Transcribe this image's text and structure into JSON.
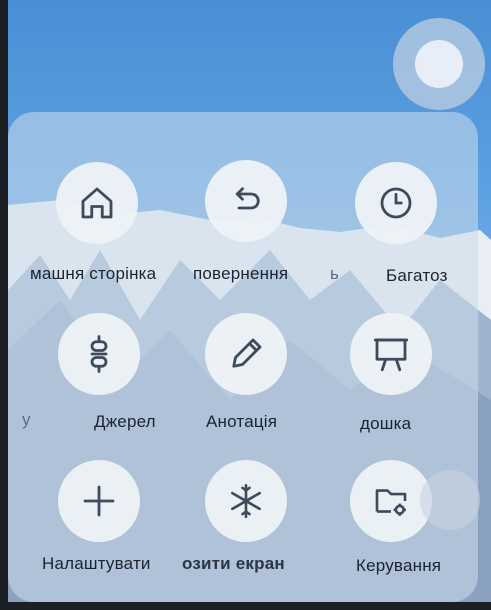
{
  "menu": {
    "items": [
      {
        "label": "машня сторінка",
        "icon": "home-icon"
      },
      {
        "label": "повернення",
        "icon": "undo-icon"
      },
      {
        "label": "Багатоз",
        "icon": "clock-icon"
      },
      {
        "label": "Джерел",
        "icon": "plug-icon"
      },
      {
        "label": "Анотація",
        "icon": "pen-icon"
      },
      {
        "label": "дошка",
        "icon": "whiteboard-icon"
      },
      {
        "label": "Налаштувати",
        "icon": "plus-icon"
      },
      {
        "label": "озити екран",
        "icon": "snowflake-icon"
      },
      {
        "label": "Керування",
        "icon": "folder-gear-icon"
      }
    ],
    "stray_labels": [
      "ь",
      "у"
    ]
  },
  "colors": {
    "icon": "#3d4b5c",
    "panel": "#cddcea",
    "accent": "#4a8fd4"
  }
}
